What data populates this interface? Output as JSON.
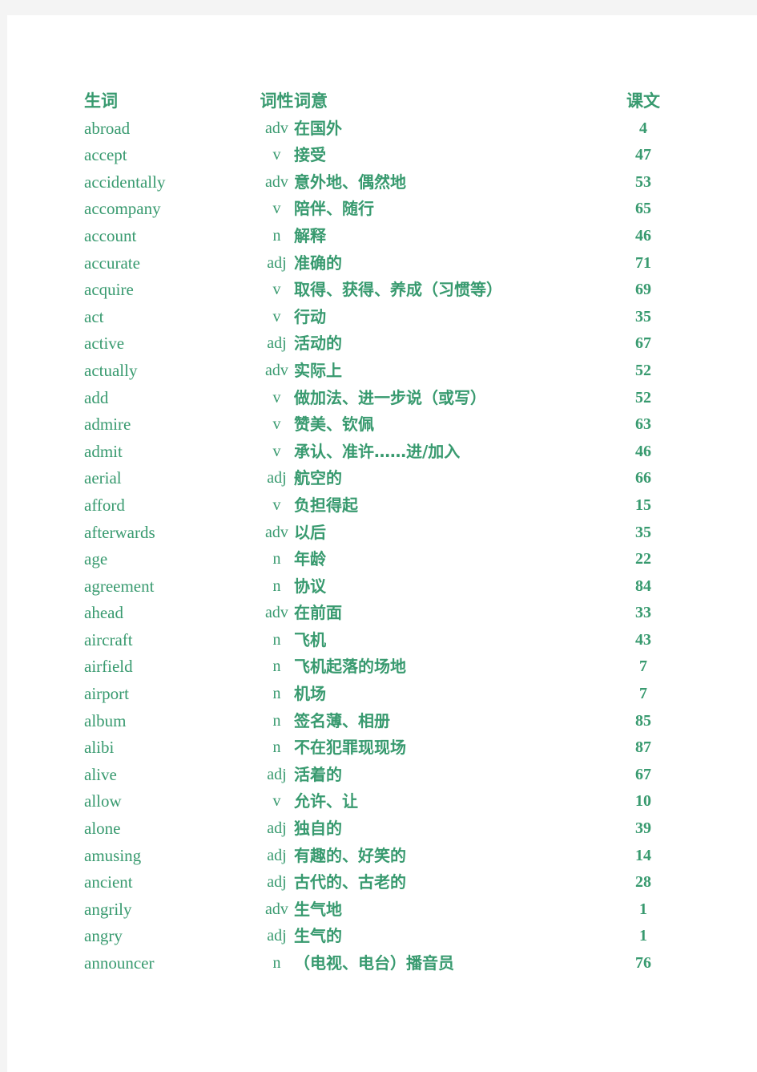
{
  "document": {
    "title": "生词表",
    "text_color": "#389a6f",
    "page_background": "#ffffff",
    "canvas_background": "#f4f4f4"
  },
  "table": {
    "headers": {
      "word": "生词",
      "pos": "词性",
      "meaning": "词意",
      "lesson": "课文"
    },
    "rows": [
      {
        "word": "abroad",
        "pos": "adv",
        "meaning": "在国外",
        "lesson": "4"
      },
      {
        "word": "accept",
        "pos": "v",
        "meaning": "接受",
        "lesson": "47"
      },
      {
        "word": "accidentally",
        "pos": "adv",
        "meaning": "意外地、偶然地",
        "lesson": "53"
      },
      {
        "word": "accompany",
        "pos": "v",
        "meaning": "陪伴、随行",
        "lesson": "65"
      },
      {
        "word": "account",
        "pos": "n",
        "meaning": "解释",
        "lesson": "46"
      },
      {
        "word": "accurate",
        "pos": "adj",
        "meaning": "准确的",
        "lesson": "71"
      },
      {
        "word": "acquire",
        "pos": "v",
        "meaning": "取得、获得、养成（习惯等）",
        "lesson": "69"
      },
      {
        "word": "act",
        "pos": "v",
        "meaning": "行动",
        "lesson": "35"
      },
      {
        "word": "active",
        "pos": "adj",
        "meaning": "活动的",
        "lesson": "67"
      },
      {
        "word": "actually",
        "pos": "adv",
        "meaning": "实际上",
        "lesson": "52"
      },
      {
        "word": "add",
        "pos": "v",
        "meaning": "做加法、进一步说（或写）",
        "lesson": "52"
      },
      {
        "word": "admire",
        "pos": "v",
        "meaning": "赞美、钦佩",
        "lesson": "63"
      },
      {
        "word": "admit",
        "pos": "v",
        "meaning": "承认、准许……进/加入",
        "lesson": "46"
      },
      {
        "word": "aerial",
        "pos": "adj",
        "meaning": "航空的",
        "lesson": "66"
      },
      {
        "word": "afford",
        "pos": "v",
        "meaning": "负担得起",
        "lesson": "15"
      },
      {
        "word": "afterwards",
        "pos": "adv",
        "meaning": "以后",
        "lesson": "35"
      },
      {
        "word": "age",
        "pos": "n",
        "meaning": "年龄",
        "lesson": "22"
      },
      {
        "word": "agreement",
        "pos": "n",
        "meaning": "协议",
        "lesson": "84"
      },
      {
        "word": "ahead",
        "pos": "adv",
        "meaning": "在前面",
        "lesson": "33"
      },
      {
        "word": "aircraft",
        "pos": "n",
        "meaning": "飞机",
        "lesson": "43"
      },
      {
        "word": "airfield",
        "pos": "n",
        "meaning": "飞机起落的场地",
        "lesson": "7"
      },
      {
        "word": "airport",
        "pos": "n",
        "meaning": "机场",
        "lesson": "7"
      },
      {
        "word": "album",
        "pos": "n",
        "meaning": "签名薄、相册",
        "lesson": "85"
      },
      {
        "word": "alibi",
        "pos": "n",
        "meaning": "不在犯罪现现场",
        "lesson": "87"
      },
      {
        "word": "alive",
        "pos": "adj",
        "meaning": "活着的",
        "lesson": "67"
      },
      {
        "word": "allow",
        "pos": "v",
        "meaning": "允许、让",
        "lesson": "10"
      },
      {
        "word": "alone",
        "pos": "adj",
        "meaning": "独自的",
        "lesson": "39"
      },
      {
        "word": "amusing",
        "pos": "adj",
        "meaning": "有趣的、好笑的",
        "lesson": "14"
      },
      {
        "word": "ancient",
        "pos": "adj",
        "meaning": "古代的、古老的",
        "lesson": "28"
      },
      {
        "word": "angrily",
        "pos": "adv",
        "meaning": "生气地",
        "lesson": "1"
      },
      {
        "word": "angry",
        "pos": "adj",
        "meaning": "生气的",
        "lesson": "1"
      },
      {
        "word": "announcer",
        "pos": "n",
        "meaning": "（电视、电台）播音员",
        "lesson": "76"
      }
    ]
  }
}
